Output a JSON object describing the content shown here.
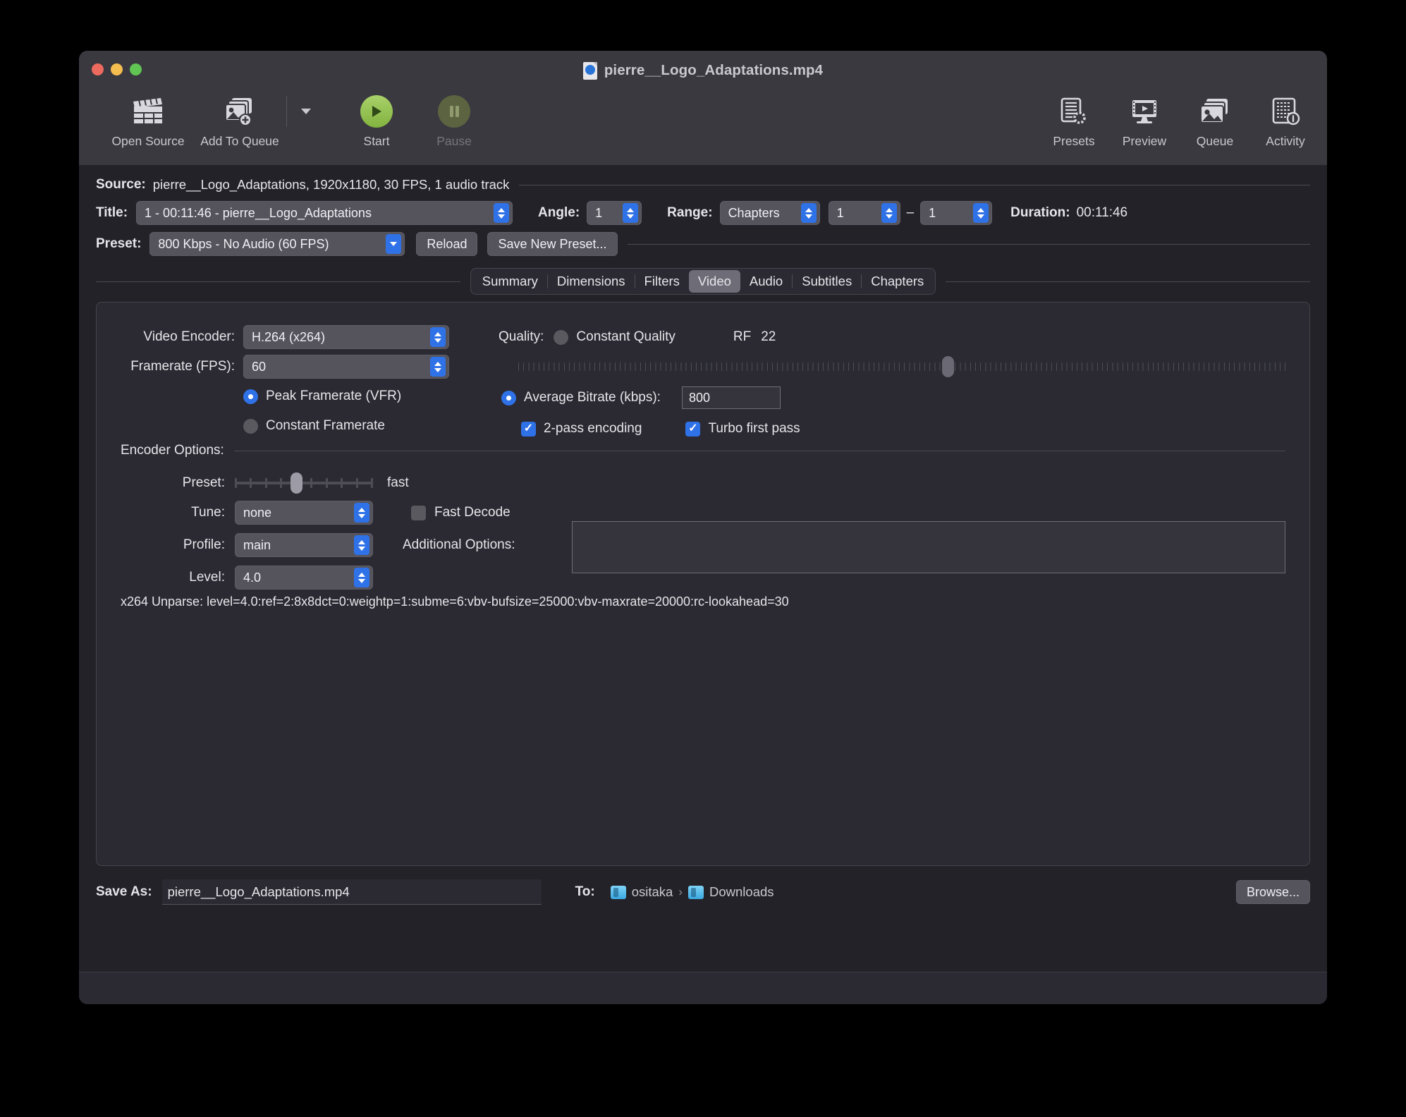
{
  "window": {
    "title": "pierre__Logo_Adaptations.mp4",
    "file_icon": "quicktime-file-icon"
  },
  "toolbar": {
    "open_source": "Open Source",
    "add_to_queue": "Add To Queue",
    "start": "Start",
    "pause": "Pause",
    "presets": "Presets",
    "preview": "Preview",
    "queue": "Queue",
    "activity": "Activity"
  },
  "source": {
    "label": "Source:",
    "value": "pierre__Logo_Adaptations, 1920x1180, 30 FPS, 1 audio track"
  },
  "title_row": {
    "label": "Title:",
    "value": "1 - 00:11:46 - pierre__Logo_Adaptations",
    "angle_label": "Angle:",
    "angle_value": "1",
    "range_label": "Range:",
    "range_type": "Chapters",
    "range_start": "1",
    "range_dash": "–",
    "range_end": "1",
    "duration_label": "Duration:",
    "duration_value": "00:11:46"
  },
  "preset_row": {
    "label": "Preset:",
    "value": "800 Kbps - No Audio (60 FPS)",
    "reload": "Reload",
    "save_new": "Save New Preset..."
  },
  "tabs": [
    {
      "label": "Summary",
      "active": false
    },
    {
      "label": "Dimensions",
      "active": false
    },
    {
      "label": "Filters",
      "active": false
    },
    {
      "label": "Video",
      "active": true
    },
    {
      "label": "Audio",
      "active": false
    },
    {
      "label": "Subtitles",
      "active": false
    },
    {
      "label": "Chapters",
      "active": false
    }
  ],
  "video": {
    "encoder_label": "Video Encoder:",
    "encoder_value": "H.264 (x264)",
    "framerate_label": "Framerate (FPS):",
    "framerate_value": "60",
    "peak_framerate": "Peak Framerate (VFR)",
    "peak_selected": true,
    "constant_framerate": "Constant Framerate",
    "quality_label": "Quality:",
    "constant_quality": "Constant Quality",
    "constant_quality_selected": false,
    "rf_label": "RF",
    "rf_value": "22",
    "rf_percent": 56,
    "avg_bitrate_label": "Average Bitrate (kbps):",
    "avg_bitrate_selected": true,
    "avg_bitrate_value": "800",
    "two_pass": "2-pass encoding",
    "two_pass_checked": true,
    "turbo": "Turbo first pass",
    "turbo_checked": true
  },
  "encoder_options": {
    "section_label": "Encoder Options:",
    "preset_label": "Preset:",
    "preset_slider_value": "fast",
    "preset_slider_index": 4,
    "preset_slider_ticks": 10,
    "tune_label": "Tune:",
    "tune_value": "none",
    "fast_decode": "Fast Decode",
    "fast_decode_checked": false,
    "profile_label": "Profile:",
    "profile_value": "main",
    "level_label": "Level:",
    "level_value": "4.0",
    "additional_options_label": "Additional Options:",
    "additional_options_value": ""
  },
  "unparse": "x264 Unparse: level=4.0:ref=2:8x8dct=0:weightp=1:subme=6:vbv-bufsize=25000:vbv-maxrate=20000:rc-lookahead=30",
  "bottom": {
    "save_as_label": "Save As:",
    "save_as_value": "pierre__Logo_Adaptations.mp4",
    "to_label": "To:",
    "path_1": "ositaka",
    "path_sep": "›",
    "path_2": "Downloads",
    "browse": "Browse..."
  },
  "colors": {
    "accent_blue": "#2f72e8",
    "window_bg": "#232229",
    "chrome_bg": "#3a3940",
    "panel_bg": "#2b2a32",
    "start_green": "#82b33f"
  }
}
